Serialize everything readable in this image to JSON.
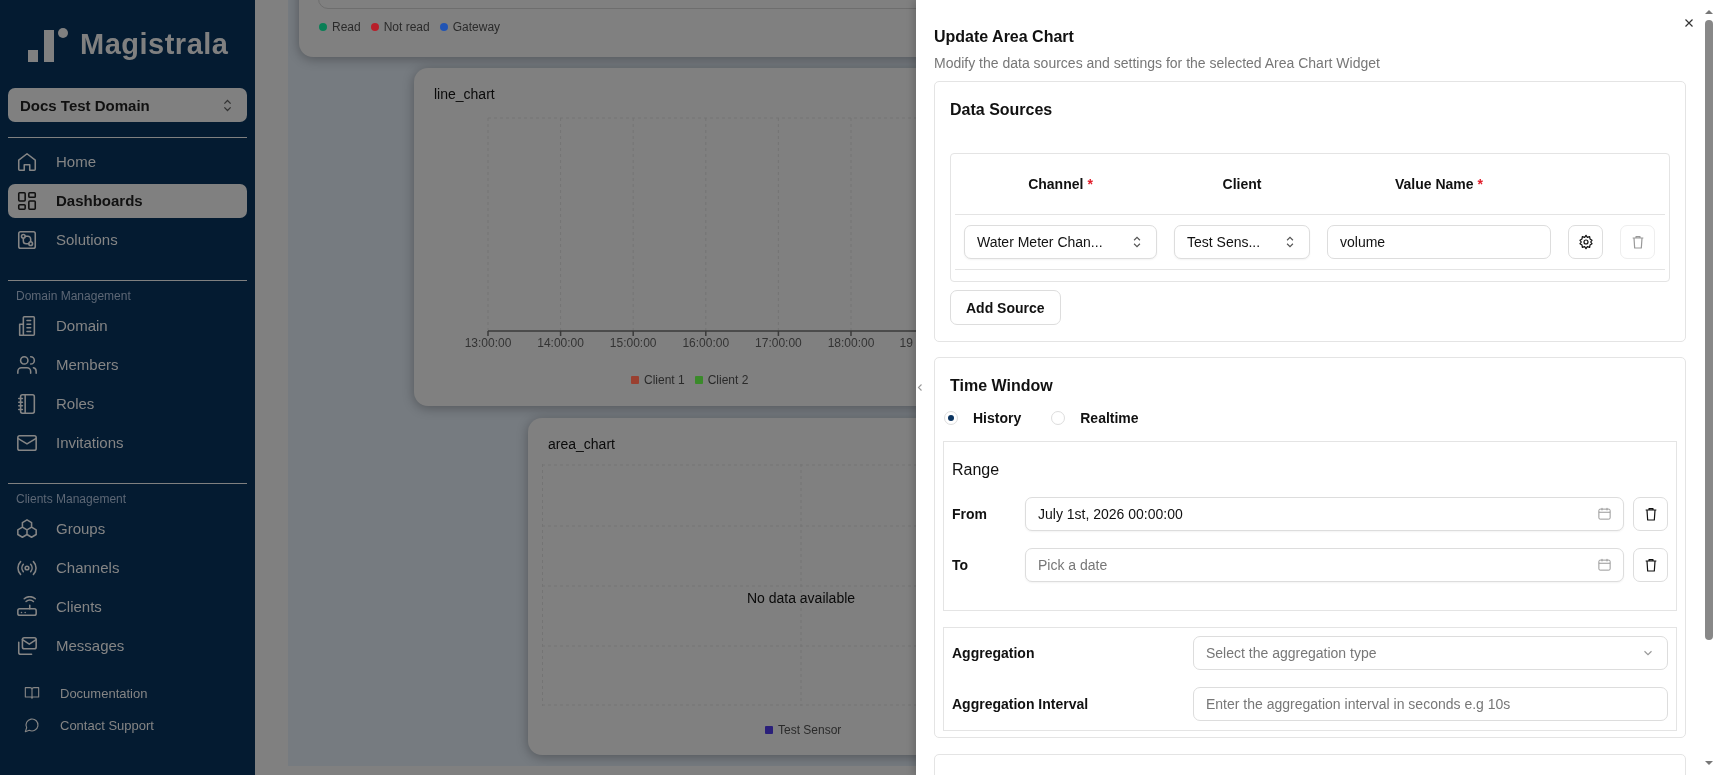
{
  "sidebar": {
    "brand": "Magistrala",
    "domain_selector": "Docs Test Domain",
    "nav_groups": [
      {
        "items": [
          {
            "label": "Home",
            "selected": false
          },
          {
            "label": "Dashboards",
            "selected": true
          },
          {
            "label": "Solutions",
            "selected": false
          }
        ]
      },
      {
        "heading": "Domain Management",
        "items": [
          {
            "label": "Domain",
            "selected": false
          },
          {
            "label": "Members",
            "selected": false
          },
          {
            "label": "Roles",
            "selected": false
          },
          {
            "label": "Invitations",
            "selected": false
          }
        ]
      },
      {
        "heading": "Clients Management",
        "items": [
          {
            "label": "Groups",
            "selected": false
          },
          {
            "label": "Channels",
            "selected": false
          },
          {
            "label": "Clients",
            "selected": false
          },
          {
            "label": "Messages",
            "selected": false
          }
        ]
      }
    ],
    "footer_links": [
      "Documentation",
      "Contact Support"
    ]
  },
  "dashboard": {
    "widgets": [
      {
        "kind": "legend_only",
        "legend": [
          {
            "label": "Read",
            "color": "#0a7f56"
          },
          {
            "label": "Not read",
            "color": "#b81f2a"
          },
          {
            "label": "Gateway",
            "color": "#2154b4"
          }
        ]
      },
      {
        "kind": "line",
        "title": "line_chart",
        "x_labels": [
          "13:00:00",
          "14:00:00",
          "15:00:00",
          "16:00:00",
          "17:00:00",
          "18:00:00",
          "19"
        ],
        "legend": [
          {
            "label": "Client 1",
            "color": "#9a4030"
          },
          {
            "label": "Client 2",
            "color": "#3a8a2a"
          }
        ]
      },
      {
        "kind": "area",
        "title": "area_chart",
        "empty_message": "No data available",
        "legend": [
          {
            "label": "Test Sensor",
            "color": "#2a1f7a"
          }
        ]
      }
    ]
  },
  "dialog": {
    "title": "Update Area Chart",
    "description": "Modify the data sources and settings for the selected Area Chart Widget",
    "data_sources": {
      "title": "Data Sources",
      "columns": [
        {
          "label": "Channel",
          "required_mark": "*"
        },
        {
          "label": "Client"
        },
        {
          "label": "Value Name",
          "required_mark": "*"
        }
      ],
      "rows": [
        {
          "channel": "Water Meter Chan...",
          "client": "Test Sens...",
          "value_name": "volume"
        }
      ],
      "add_button": "Add Source"
    },
    "time_window": {
      "title": "Time Window",
      "modes": [
        {
          "label": "History",
          "selected": true
        },
        {
          "label": "Realtime",
          "selected": false
        }
      ],
      "range": {
        "title": "Range",
        "fields": [
          {
            "label": "From",
            "value": "July 1st, 2026 00:00:00"
          },
          {
            "label": "To",
            "placeholder": "Pick a date"
          }
        ]
      },
      "aggregation": {
        "label": "Aggregation",
        "placeholder": "Select the aggregation type"
      },
      "aggregation_interval": {
        "label": "Aggregation Interval",
        "placeholder": "Enter the aggregation interval in seconds e.g 10s"
      }
    }
  }
}
